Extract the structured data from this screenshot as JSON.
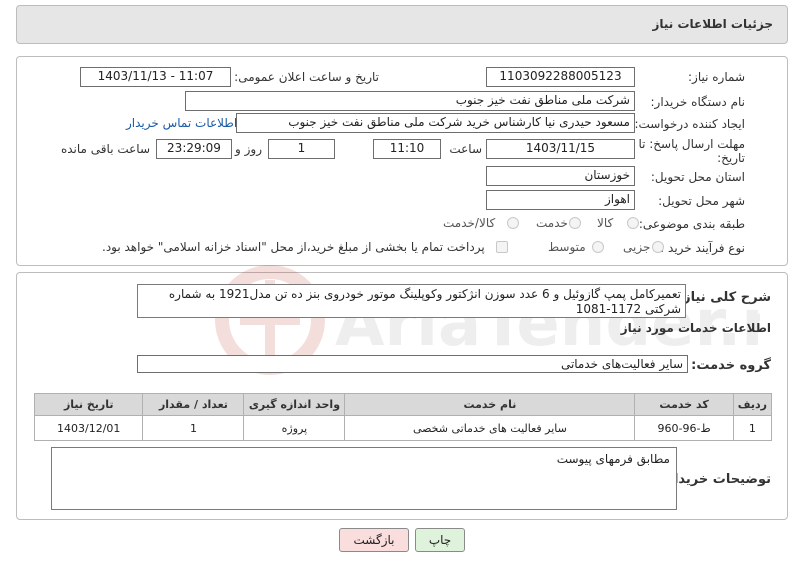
{
  "header": {
    "title": "جزئیات اطلاعات نیاز"
  },
  "form": {
    "need_number_label": "شماره نیاز:",
    "need_number": "1103092288005123",
    "announce_label": "تاریخ و ساعت اعلان عمومی:",
    "announce_value": "1403/11/13 - 11:07",
    "buyer_org_label": "نام دستگاه خریدار:",
    "buyer_org": "شرکت ملی مناطق نفت خیز جنوب",
    "creator_label": "ایجاد کننده درخواست:",
    "creator": "مسعود حیدری نیا کارشناس خرید شرکت ملی مناطق نفت خیز جنوب",
    "contact_link": "اطلاعات تماس خریدار",
    "deadline_label_1": "مهلت ارسال پاسخ: تا",
    "deadline_label_2": "تاریخ:",
    "deadline_date": "1403/11/15",
    "time_label": "ساعت",
    "deadline_time": "11:10",
    "days_value": "1",
    "days_label": "روز و",
    "remaining_value": "23:29:09",
    "remaining_label": "ساعت باقی مانده",
    "province_label": "استان محل تحویل:",
    "province": "خوزستان",
    "city_label": "شهر محل تحویل:",
    "city": "اهواز",
    "category_label": "طبقه بندی موضوعی:",
    "category_options": [
      "کالا",
      "خدمت",
      "کالا/خدمت"
    ],
    "process_label": "نوع فرآیند خرید :",
    "process_options": [
      "جزیی",
      "متوسط"
    ],
    "treasury_note": "پرداخت تمام یا بخشی از مبلغ خرید،از محل \"اسناد خزانه اسلامی\" خواهد بود."
  },
  "summary": {
    "label": "شرح کلی نیاز:",
    "text": "تعمیرکامل پمپ گازوئیل و 6 عدد سوزن انژکتور وکوپلینگ موتور خودروی بنز ده تن مدل1921 به شماره شرکتی 1172-1081",
    "services_title": "اطلاعات خدمات مورد نیاز",
    "group_label": "گروه خدمت:",
    "group_value": "سایر فعالیت‌های خدماتی"
  },
  "table": {
    "headers": [
      "ردیف",
      "کد خدمت",
      "نام خدمت",
      "واحد اندازه گیری",
      "تعداد / مقدار",
      "تاریخ نیاز"
    ],
    "rows": [
      [
        "1",
        "ط-96-960",
        "سایر فعالیت های خدماتی شخصی",
        "پروژه",
        "1",
        "1403/12/01"
      ]
    ]
  },
  "notes": {
    "label": "توضیحات خریدار:",
    "text": "مطابق فرمهای پیوست"
  },
  "buttons": {
    "print": "چاپ",
    "back": "بازگشت"
  },
  "watermark": {
    "text": "AriaTender.neT"
  }
}
